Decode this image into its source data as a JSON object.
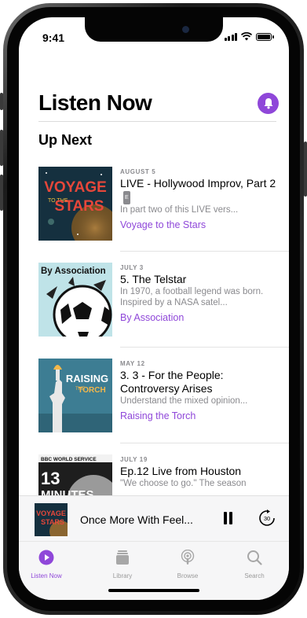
{
  "status": {
    "time": "9:41"
  },
  "header": {
    "title": "Listen Now"
  },
  "section_title": "Up Next",
  "episodes": [
    {
      "date": "AUGUST 5",
      "title": "LIVE - Hollywood Improv, Part 2",
      "explicit": "E",
      "description": "In part two of this LIVE vers...",
      "show": "Voyage to the Stars",
      "art_text": [
        "VOYAGE",
        "TO THE",
        "STARS"
      ]
    },
    {
      "date": "JULY 3",
      "title": "5. The Telstar",
      "description": "In 1970, a football legend was born. Inspired by a NASA satel...",
      "show": "By Association",
      "art_text": [
        "By Association"
      ]
    },
    {
      "date": "MAY 12",
      "title": "3. 3 - For the People: Controversy Arises",
      "description": "Understand the mixed opinion...",
      "show": "Raising the Torch",
      "art_text": [
        "RAISING",
        "THE",
        "TORCH"
      ]
    },
    {
      "date": "JULY 19",
      "title": "Ep.12 Live from Houston",
      "description": "\"We choose to go.\" The season",
      "show": "",
      "art_text": [
        "BBC WORLD SERVICE",
        "13",
        "MINUTES"
      ]
    }
  ],
  "player": {
    "title": "Once More With Feel...",
    "skip_label": "30"
  },
  "tabs": [
    {
      "label": "Listen Now",
      "icon": "play-circle-icon",
      "active": true
    },
    {
      "label": "Library",
      "icon": "library-icon",
      "active": false
    },
    {
      "label": "Browse",
      "icon": "podcast-icon",
      "active": false
    },
    {
      "label": "Search",
      "icon": "search-icon",
      "active": false
    }
  ],
  "colors": {
    "accent": "#8f47d9",
    "secondary_text": "#8a8a8e"
  }
}
